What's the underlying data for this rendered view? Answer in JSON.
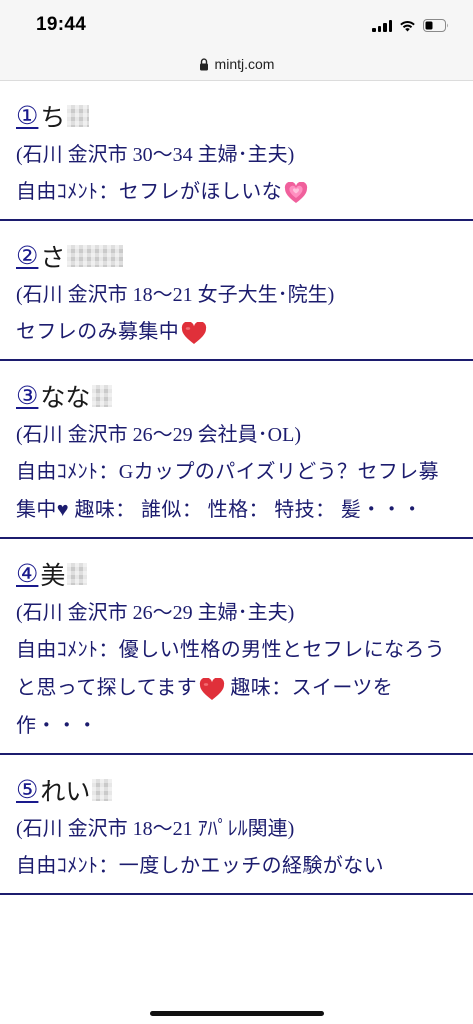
{
  "status_bar": {
    "time": "19:44"
  },
  "url_bar": {
    "domain": "mintj.com"
  },
  "entries": [
    {
      "number": "①",
      "name": "ち",
      "meta": "(石川 金沢市 30〜34 主婦･主夫)",
      "comment": "自由ｺﾒﾝﾄ：セフレがほしいな",
      "emoji": "growing-heart"
    },
    {
      "number": "②",
      "name": "さ",
      "meta": "(石川 金沢市 18〜21 女子大生･院生)",
      "comment": "セフレのみ募集中",
      "emoji": "red-heart"
    },
    {
      "number": "③",
      "name": "なな",
      "meta": "(石川 金沢市 26〜29 会社員･OL)",
      "comment": "自由ｺﾒﾝﾄ：Gカップのパイズリどう？セフレ募集中♥ 趣味： 誰似： 性格： 特技： 髪・・・"
    },
    {
      "number": "④",
      "name": "美",
      "meta": "(石川 金沢市 26〜29 主婦･主夫)",
      "comment_part1": "自由ｺﾒﾝﾄ：優しい性格の男性とセフレになろうと思って探してます",
      "comment_part2": " 趣味：スイーツを作・・・",
      "emoji": "red-heart"
    },
    {
      "number": "⑤",
      "name": "れい",
      "meta": "(石川 金沢市 18〜21 ｱﾊﾟﾚﾙ関連)",
      "comment": "自由ｺﾒﾝﾄ：一度しかエッチの経験がない"
    }
  ],
  "colors": {
    "text_navy": "#1c1c6e",
    "link_blue": "#1a1a8c",
    "heart_red": "#e0303a",
    "heart_pink": "#f0609c"
  }
}
